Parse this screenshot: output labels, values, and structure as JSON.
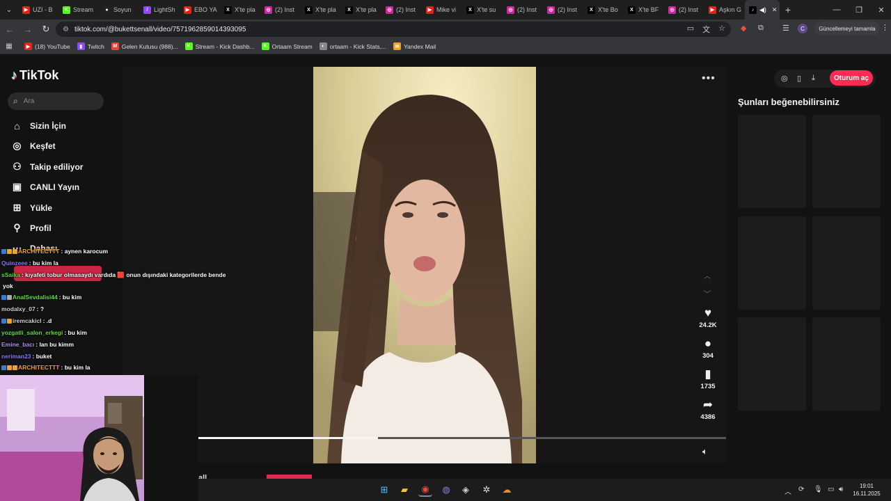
{
  "browser": {
    "tabs": [
      {
        "label": "UZI - B",
        "fav_color": "#e62117",
        "glyph": "▶"
      },
      {
        "label": "Stream",
        "fav_color": "#53fc18",
        "glyph": "K"
      },
      {
        "label": "Soyun",
        "fav_color": "#222222",
        "glyph": "●"
      },
      {
        "label": "LightSh",
        "fav_color": "#9146ff",
        "glyph": "/"
      },
      {
        "label": "EBO YA",
        "fav_color": "#e62117",
        "glyph": "▶"
      },
      {
        "label": "X'te pla",
        "fav_color": "#000000",
        "glyph": "X"
      },
      {
        "label": "(2) Inst",
        "fav_color": "#d6249f",
        "glyph": "◎"
      },
      {
        "label": "X'te pla",
        "fav_color": "#000000",
        "glyph": "X"
      },
      {
        "label": "X'te pla",
        "fav_color": "#000000",
        "glyph": "X"
      },
      {
        "label": "(2) Inst",
        "fav_color": "#d6249f",
        "glyph": "◎"
      },
      {
        "label": "Mike vi",
        "fav_color": "#e62117",
        "glyph": "▶"
      },
      {
        "label": "X'te su",
        "fav_color": "#000000",
        "glyph": "X"
      },
      {
        "label": "(2) Inst",
        "fav_color": "#d6249f",
        "glyph": "◎"
      },
      {
        "label": "(2) Inst",
        "fav_color": "#d6249f",
        "glyph": "◎"
      },
      {
        "label": "X'te Bo",
        "fav_color": "#000000",
        "glyph": "X"
      },
      {
        "label": "X'te BF",
        "fav_color": "#000000",
        "glyph": "X"
      },
      {
        "label": "(2) Inst",
        "fav_color": "#d6249f",
        "glyph": "◎"
      },
      {
        "label": "Aşkın G",
        "fav_color": "#e62117",
        "glyph": "▶"
      }
    ],
    "active_tab_glyph": "♪",
    "url": "tiktok.com/@bukettsenall/video/7571962859014393095",
    "update_label": "Güncellemeyi tamamla",
    "profile_letter": "C",
    "bookmarks": [
      {
        "label": "(18) YouTube",
        "color": "#e62117",
        "glyph": "▶"
      },
      {
        "label": "Twitch",
        "color": "#9146ff",
        "glyph": "▮"
      },
      {
        "label": "Gelen Kutusu (988)...",
        "color": "#ea4335",
        "glyph": "M"
      },
      {
        "label": "Stream - Kick Dashb...",
        "color": "#53fc18",
        "glyph": "K"
      },
      {
        "label": "Ortaam Stream",
        "color": "#53fc18",
        "glyph": "K"
      },
      {
        "label": "ortaam - Kick Stats,...",
        "color": "#888888",
        "glyph": "◐"
      },
      {
        "label": "Yandex Mail",
        "color": "#f4a11a",
        "glyph": "✉"
      }
    ]
  },
  "tiktok": {
    "logo": "TikTok",
    "search_placeholder": "Ara",
    "nav": [
      {
        "label": "Sizin İçin",
        "icon": "home-icon"
      },
      {
        "label": "Keşfet",
        "icon": "compass-icon"
      },
      {
        "label": "Takip ediliyor",
        "icon": "following-icon"
      },
      {
        "label": "CANLI Yayın",
        "icon": "live-icon"
      },
      {
        "label": "Yükle",
        "icon": "upload-icon"
      },
      {
        "label": "Profil",
        "icon": "profile-icon"
      },
      {
        "label": "Dahası",
        "icon": "more-icon"
      }
    ],
    "stats": {
      "likes": "24.2K",
      "comments": "304",
      "saves": "1735",
      "shares": "4386"
    },
    "progress": 0.34,
    "login_label": "Oturum aç",
    "suggest_title": "Şunları beğenebilirsiniz",
    "bottom_text": "all"
  },
  "chat": [
    {
      "user": "ARCHITECTTT",
      "color": "#f0a030",
      "msg": ": aynen karocum",
      "badges": [
        "#3a7bd5",
        "#e8a33c",
        "#e8a33c"
      ]
    },
    {
      "user": "Quinzeee",
      "color": "#8a7cf7",
      "msg": ": bu kim la",
      "badges": []
    },
    {
      "user": "sSaika",
      "color": "#5fdc3c",
      "msg": ": kıyafeti tobur olmasaydı vardıda 🟥 onun dışındaki kategorilerde bende",
      "badges": []
    },
    {
      "user": "",
      "color": "#ffffff",
      "msg": "yok",
      "badges": []
    },
    {
      "user": "AnalSevdalisi44",
      "color": "#5fdc3c",
      "msg": ": bu kim",
      "badges": [
        "#3a7bd5",
        "#aaaaaa"
      ]
    },
    {
      "user": "modalxy_07",
      "color": "#cfcfcf",
      "msg": ": ?",
      "badges": []
    },
    {
      "user": "iremcakicl",
      "color": "#cfcfcf",
      "msg": ": .d",
      "badges": [
        "#3a7bd5",
        "#e8a33c"
      ]
    },
    {
      "user": "yozgatli_salon_erkegi",
      "color": "#5fdc3c",
      "msg": ": bu kim",
      "badges": []
    },
    {
      "user": "Emine_bacı",
      "color": "#b38cf5",
      "msg": ": lan bu kimm",
      "badges": []
    },
    {
      "user": "neriman23",
      "color": "#8a7cf7",
      "msg": ": buket",
      "badges": []
    },
    {
      "user": "ARCHITECTTT",
      "color": "#f0a030",
      "msg": ": bu kim la",
      "badges": [
        "#3a7bd5",
        "#e8a33c",
        "#e8a33c"
      ]
    }
  ],
  "clock": {
    "time": "19:01",
    "date": "16.11.2025"
  }
}
